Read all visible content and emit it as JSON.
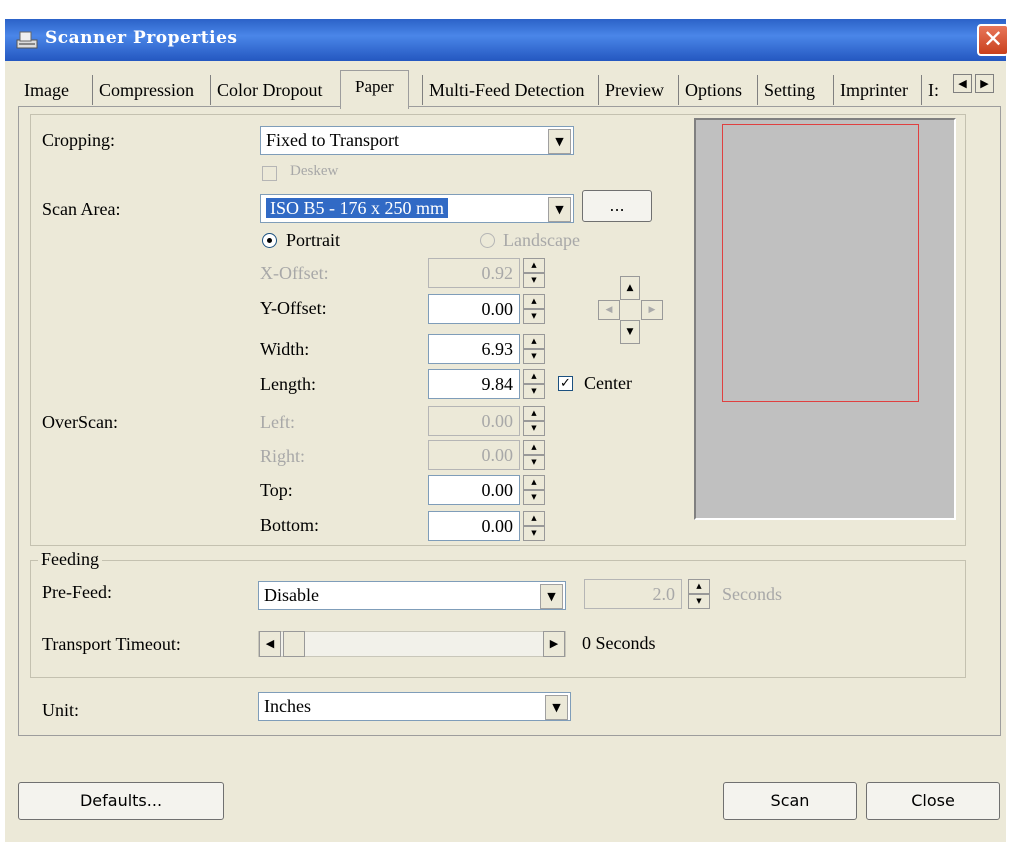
{
  "window": {
    "title": "Scanner Properties",
    "close_glyph": "✕"
  },
  "tabs": [
    {
      "label": "Image"
    },
    {
      "label": "Compression"
    },
    {
      "label": "Color Dropout"
    },
    {
      "label": "Paper"
    },
    {
      "label": "Multi-Feed Detection"
    },
    {
      "label": "Preview"
    },
    {
      "label": "Options"
    },
    {
      "label": "Setting"
    },
    {
      "label": "Imprinter"
    },
    {
      "label": "I:"
    }
  ],
  "paper": {
    "cropping_label": "Cropping:",
    "cropping_value": "Fixed to Transport",
    "deskew_label": "Deskew",
    "scan_area_label": "Scan Area:",
    "scan_area_value": "ISO B5 - 176 x 250 mm",
    "browse_label": "...",
    "portrait_label": "Portrait",
    "landscape_label": "Landscape",
    "x_offset_label": "X-Offset:",
    "x_offset_value": "0.92",
    "y_offset_label": "Y-Offset:",
    "y_offset_value": "0.00",
    "width_label": "Width:",
    "width_value": "6.93",
    "length_label": "Length:",
    "length_value": "9.84",
    "center_label": "Center",
    "overscan_label": "OverScan:",
    "left_label": "Left:",
    "left_value": "0.00",
    "right_label": "Right:",
    "right_value": "0.00",
    "top_label": "Top:",
    "top_value": "0.00",
    "bottom_label": "Bottom:",
    "bottom_value": "0.00"
  },
  "feeding": {
    "group_label": "Feeding",
    "prefeed_label": "Pre-Feed:",
    "prefeed_value": "Disable",
    "prefeed_seconds_value": "2.0",
    "seconds_label": "Seconds",
    "timeout_label": "Transport Timeout:",
    "timeout_value": "0 Seconds"
  },
  "unit": {
    "label": "Unit:",
    "value": "Inches"
  },
  "buttons": {
    "defaults": "Defaults...",
    "scan": "Scan",
    "close": "Close"
  },
  "colors": {
    "titlebar": "#2b62c8",
    "selection": "#316ac5",
    "preview_bg": "#c0c0c0",
    "scan_area_outline": "#e04040"
  }
}
